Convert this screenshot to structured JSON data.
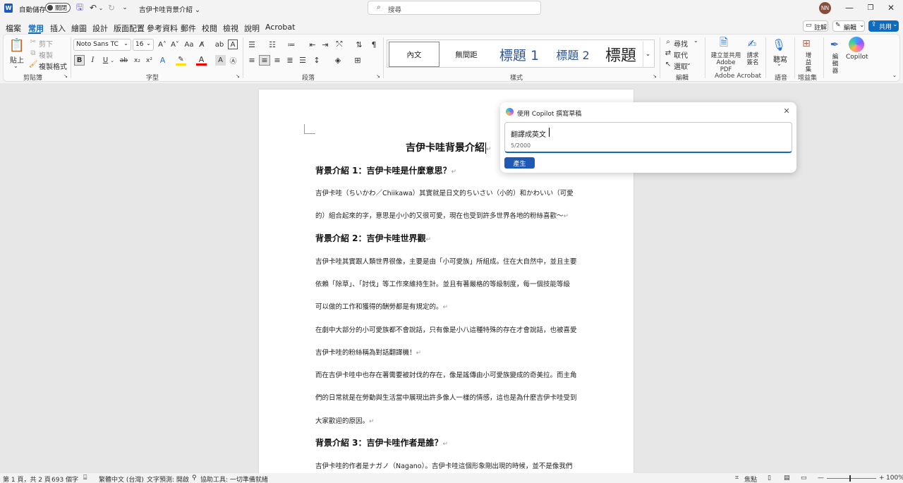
{
  "titlebar": {
    "autosave_label": "自動儲存",
    "toggle_state": "關閉",
    "doc_title": "吉伊卡哇背景介紹",
    "search_placeholder": "搜尋",
    "avatar": "NN"
  },
  "menu": {
    "items": [
      "檔案",
      "常用",
      "插入",
      "繪圖",
      "設計",
      "版面配置",
      "參考資料",
      "郵件",
      "校閱",
      "檢視",
      "說明",
      "Acrobat"
    ],
    "active": 1,
    "comment": "註解",
    "editing": "編輯",
    "share": "共用"
  },
  "ribbon": {
    "clipboard": {
      "paste": "貼上",
      "cut": "剪下",
      "copy": "複製",
      "format_painter": "複製格式",
      "label": "剪貼簿"
    },
    "font": {
      "name": "Noto Sans TC",
      "size": "16",
      "label": "字型"
    },
    "paragraph": {
      "label": "段落"
    },
    "styles": {
      "items": [
        "內文",
        "無間距",
        "標題 1",
        "標題 2",
        "標題"
      ],
      "label": "樣式"
    },
    "editing": {
      "find": "尋找",
      "replace": "取代",
      "select": "選取",
      "label": "編輯"
    },
    "acrobat": {
      "create_pdf": "建立並共用 Adobe PDF",
      "request_sign": "請求簽名",
      "label": "Adobe Acrobat"
    },
    "voice": {
      "dictate": "聽寫",
      "label": "語音"
    },
    "addins": {
      "addins": "增益集",
      "label": "增益集"
    },
    "editor": {
      "editor": "編輯器"
    },
    "copilot": {
      "copilot": "Copilot"
    }
  },
  "document": {
    "title": "吉伊卡哇背景介紹",
    "h2_1": "背景介紹 1：吉伊卡哇是什麼意思？",
    "p1_l1": "吉伊卡哇（ちいかわ／Chiikawa）其實就是日文的ちいさい（小的）和かわいい（可愛",
    "p1_l2": "的）組合起來的字，意思是小小的又很可愛，現在也受到許多世界各地的粉絲喜歡～",
    "h2_2": "背景介紹 2：吉伊卡哇世界觀",
    "p2_l1": "吉伊卡哇其實跟人類世界很像，主要是由「小可愛族」所組成。住在大自然中，並且主要",
    "p2_l2": "依賴「除草」、「討伐」等工作來維持生計。並且有著嚴格的等級制度，每一個技能等級",
    "p2_l3": "可以做的工作和獲得的酬勞都是有規定的。",
    "p3_l1": "在劇中大部分的小可愛族都不會說話，只有像是小八這種特殊的存在才會說話，也被喜愛",
    "p3_l2": "吉伊卡哇的粉絲稱為對話翻譯機！",
    "p4_l1": "而在吉伊卡哇中也存在著需要被討伐的存在，像是謠傳由小可愛族變成的奇美拉。而主角",
    "p4_l2": "們的日常就是在勞動與生活當中展現出許多像人一樣的情感，這也是為什麼吉伊卡哇受到",
    "p4_l3": "大家歡迎的原因。",
    "h2_3": "背景介紹 3：吉伊卡哇作者是誰？",
    "p5_l1": "吉伊卡哇的作者是ナガノ（Nagano）。吉伊卡哇這個形象剛出現的時候，並不是像我們"
  },
  "copilot_panel": {
    "header": "使用 Copilot 撰寫草稿",
    "input_value": "翻譯成英文",
    "counter": "5/2000",
    "generate": "產生"
  },
  "status": {
    "page": "第 1 頁，共 2 頁",
    "words": "693 個字",
    "language": "繁體中文 (台灣)",
    "prediction": "文字預測: 開啟",
    "accessibility": "協助工具: 一切準備就緒",
    "focus": "焦點",
    "zoom": "100%"
  }
}
